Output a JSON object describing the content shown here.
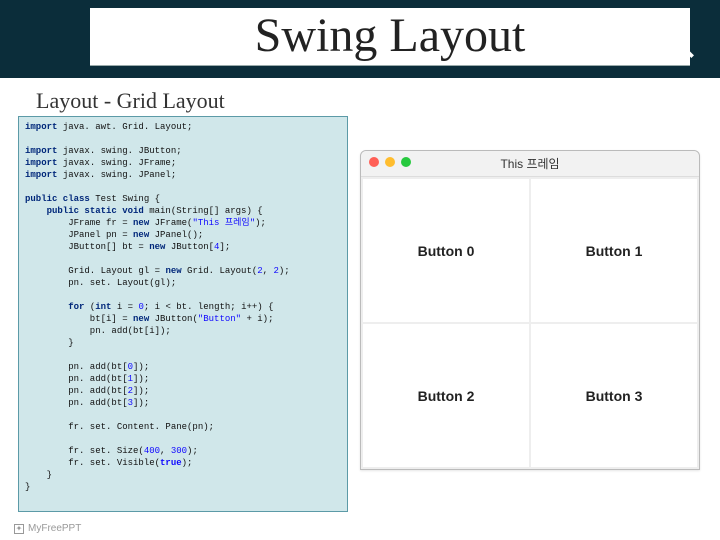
{
  "title": "Swing Layout",
  "subtitle": "Layout - Grid Layout",
  "watermark": "MyFreePPT",
  "icons": {
    "magnify": "magnify-icon"
  },
  "code": {
    "imports": [
      "java. awt. Grid. Layout;",
      "javax. swing. JButton;",
      "javax. swing. JFrame;",
      "javax. swing. JPanel;"
    ],
    "class_name": "Test Swing",
    "frame_title": "\"This 프레임\"",
    "button_array_size": "4",
    "grid_rows": "2",
    "grid_cols": "2",
    "loop_start": "0",
    "button_label": "\"Button\"",
    "adds": [
      "0",
      "1",
      "2",
      "3"
    ],
    "frame_w": "400",
    "frame_h": "300",
    "visible": "true"
  },
  "window": {
    "title": "This 프레임",
    "buttons": [
      "Button 0",
      "Button 1",
      "Button 2",
      "Button 3"
    ]
  }
}
